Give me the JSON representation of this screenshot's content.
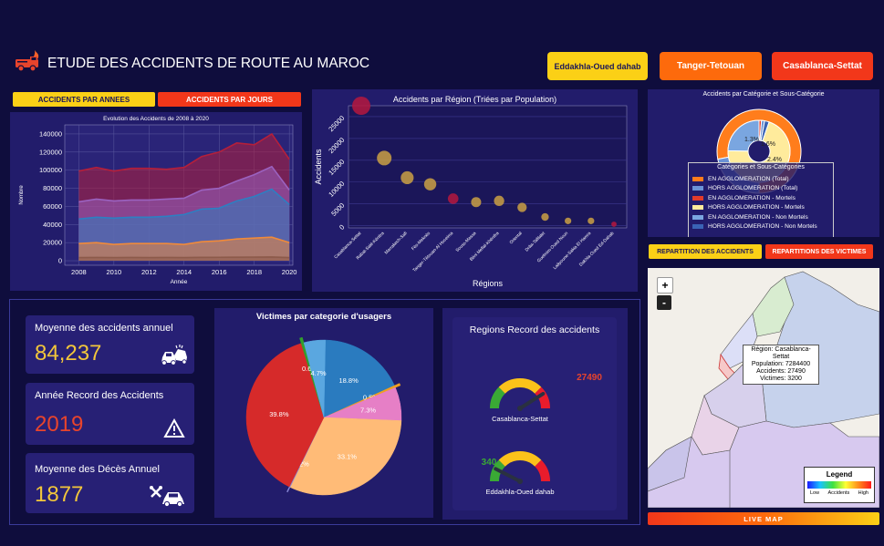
{
  "header": {
    "title": "ETUDE DES ACCIDENTS DE ROUTE AU MAROC",
    "region_buttons": [
      "Eddakhla-Oued dahab",
      "Tanger-Tetouan",
      "Casablanca-Settat"
    ]
  },
  "tabs_left": [
    "ACCIDENTS PAR ANNEES",
    "ACCIDENTS PAR JOURS"
  ],
  "tabs_right": [
    "REPARTITION DES ACCIDENTS",
    "REPARTITIONS DES VICTIMES"
  ],
  "kpis": [
    {
      "title": "Moyenne des accidents annuel",
      "value": "84,237",
      "color": "#f2c63b",
      "icon": "car-crash-icon"
    },
    {
      "title": "Année Record des Accidents",
      "value": "2019",
      "color": "#e8442c",
      "icon": "warning-icon"
    },
    {
      "title": "Moyenne des Décès Annuel",
      "value": "1877",
      "color": "#f2c63b",
      "icon": "car-repair-icon"
    }
  ],
  "record": {
    "title": "Regions Record des accidents",
    "gauges": [
      {
        "label": "Casablanca-Settat",
        "value": "27490",
        "value_color": "#e8442c",
        "level": 0.82
      },
      {
        "label": "Eddakhla-Oued dahab",
        "value": "340",
        "value_color": "#3aa935",
        "level": 0.15
      }
    ]
  },
  "map": {
    "zoom_in": "+",
    "zoom_out": "-",
    "tooltip": [
      "Région: Casablanca-Settat",
      "Population: 7284400",
      "Accidents: 27490",
      "Victimes: 3200"
    ],
    "legend_title": "Legend",
    "legend_scale": [
      "Low",
      "Accidents",
      "High"
    ],
    "live_button": "LIVE MAP"
  },
  "chart_data": [
    {
      "type": "area",
      "title": "Evolution des Accidents de 2008 à 2020",
      "xlabel": "Année",
      "ylabel": "Nombre",
      "xlim": [
        2007.2,
        2020.2
      ],
      "ylim": [
        -5000,
        150000
      ],
      "xticks": [
        2008,
        2010,
        2012,
        2014,
        2016,
        2018,
        2020
      ],
      "yticks": [
        0,
        20000,
        40000,
        60000,
        80000,
        100000,
        120000,
        140000
      ],
      "x": [
        2008,
        2009,
        2010,
        2011,
        2012,
        2013,
        2014,
        2015,
        2016,
        2017,
        2018,
        2019,
        2020
      ],
      "grid": true,
      "series": [
        {
          "color": "#b51f3a",
          "values": [
            99000,
            103000,
            99000,
            102000,
            102000,
            101000,
            103000,
            115000,
            120000,
            130000,
            128000,
            140000,
            112000
          ]
        },
        {
          "color": "#9b62c0",
          "values": [
            65000,
            68000,
            66000,
            67000,
            67000,
            68000,
            69000,
            78000,
            80000,
            88000,
            95000,
            104000,
            78000
          ]
        },
        {
          "color": "#2d7fc2",
          "values": [
            46000,
            48000,
            47000,
            48000,
            48000,
            49000,
            51000,
            57000,
            58000,
            66000,
            71000,
            79000,
            62000
          ]
        },
        {
          "color": "#f08a3a",
          "values": [
            19000,
            20000,
            18000,
            19000,
            19000,
            19000,
            18000,
            21000,
            22000,
            24000,
            25000,
            26000,
            20000
          ]
        },
        {
          "color": "#8c5a4a",
          "values": [
            3500,
            3600,
            3500,
            3600,
            3500,
            3600,
            3500,
            3700,
            3800,
            3900,
            4000,
            4100,
            3500
          ]
        }
      ]
    },
    {
      "type": "scatter",
      "title": "Accidents par Région (Triées par Population)",
      "xlabel": "Régions",
      "ylabel": "Accidents",
      "ylim": [
        -500,
        27500
      ],
      "yticks": [
        0,
        5000,
        10000,
        15000,
        20000,
        25000
      ],
      "categories": [
        "Casablanca-Settat",
        "Rabat-Salé-Kénitra",
        "Marrakech-Safi",
        "Fès-Meknès",
        "Tanger-Tétouan-Al Hoceima",
        "Souss-Massa",
        "Béni Mellal-Khénifra",
        "Oriental",
        "Drâa-Tafilalet",
        "Guelmim-Oued Noun",
        "Laâyoune-Sakia El Hamra",
        "Dakhla-Oued Ed-Dahab"
      ],
      "values": [
        27490,
        15500,
        11000,
        9500,
        6200,
        5400,
        5700,
        4200,
        2000,
        1100,
        1100,
        340
      ],
      "colors": [
        "#b5173e",
        "#caa044",
        "#caa044",
        "#caa044",
        "#b5173e",
        "#caa044",
        "#caa044",
        "#caa044",
        "#caa044",
        "#caa044",
        "#caa044",
        "#b5173e"
      ]
    },
    {
      "type": "pie",
      "title": "Accidents par Catégorie et Sous-Catégorie",
      "labels_shown": [
        "1.3%",
        "1.6%",
        "2.4%"
      ],
      "legend_title": "Catégories et Sous-Catégories",
      "legend": [
        {
          "label": "EN AGGLOMERATION (Total)",
          "color": "#ff7d1c"
        },
        {
          "label": "HORS AGGLOMERATION (Total)",
          "color": "#6b93d6"
        },
        {
          "label": "EN AGGLOMERATION - Mortels",
          "color": "#e33b2b"
        },
        {
          "label": "HORS AGGLOMERATION - Mortels",
          "color": "#ffeb9c"
        },
        {
          "label": "EN AGGLOMERATION - Non Mortels",
          "color": "#7aa6e0"
        },
        {
          "label": "HORS AGGLOMERATION - Non Mortels",
          "color": "#3a63b5"
        }
      ],
      "outer": [
        {
          "value": 0.78,
          "color": "#ff7d1c"
        },
        {
          "value": 0.22,
          "color": "#6b93d6"
        }
      ],
      "inner": [
        {
          "value": 0.013,
          "color": "#e33b2b"
        },
        {
          "value": 0.016,
          "color": "#6b93d6"
        },
        {
          "value": 0.024,
          "color": "#3a63b5"
        },
        {
          "value": 0.7,
          "color": "#ffeb9c"
        },
        {
          "value": 0.247,
          "color": "#7aa6e0"
        }
      ]
    },
    {
      "type": "pie",
      "title": "Victimes par categorie d'usagers",
      "slices": [
        {
          "label": "18.8%",
          "value": 18.8,
          "color": "#2a7bbf"
        },
        {
          "label": "0.5%",
          "value": 0.5,
          "color": "#f0a020"
        },
        {
          "label": "7.3%",
          "value": 7.3,
          "color": "#e67fc6"
        },
        {
          "label": "33.1%",
          "value": 33.1,
          "color": "#ffbb77"
        },
        {
          "label": "0.2%",
          "value": 0.2,
          "color": "#8a8ad8"
        },
        {
          "label": "39.8%",
          "value": 39.8,
          "color": "#d62a2a"
        },
        {
          "label": "0.6%",
          "value": 0.6,
          "color": "#32a02c"
        },
        {
          "label": "4.7%",
          "value": 4.7,
          "color": "#5aa7e0"
        }
      ]
    }
  ]
}
